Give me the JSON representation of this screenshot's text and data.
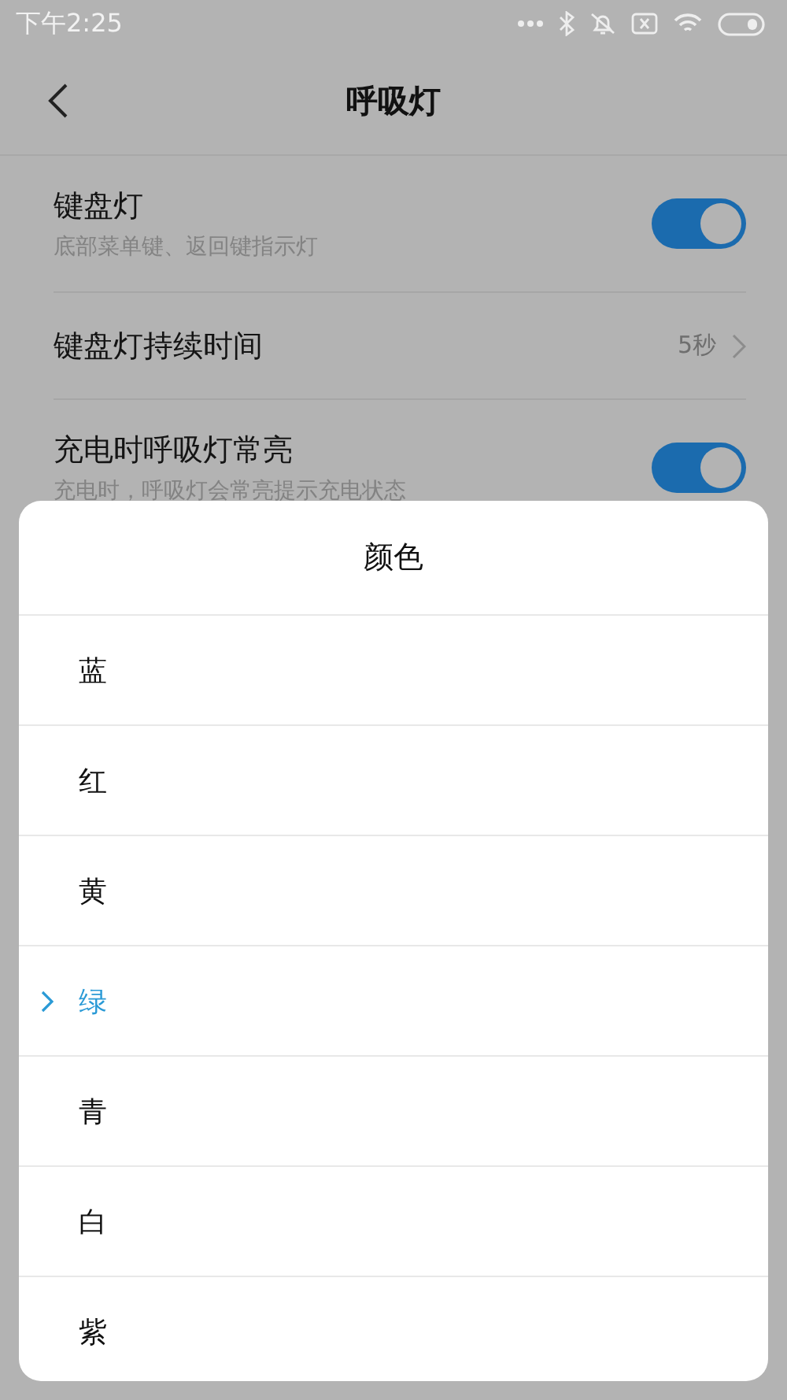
{
  "status_bar": {
    "time": "下午2:25"
  },
  "header": {
    "title": "呼吸灯"
  },
  "settings": [
    {
      "kind": "toggle",
      "title": "键盘灯",
      "subtitle": "底部菜单键、返回键指示灯",
      "on": true
    },
    {
      "kind": "value",
      "title": "键盘灯持续时间",
      "value": "5秒"
    },
    {
      "kind": "toggle",
      "title": "充电时呼吸灯常亮",
      "subtitle": "充电时，呼吸灯会常亮提示充电状态",
      "on": true
    }
  ],
  "dialog": {
    "title": "颜色",
    "options": [
      {
        "label": "蓝",
        "selected": false
      },
      {
        "label": "红",
        "selected": false
      },
      {
        "label": "黄",
        "selected": false
      },
      {
        "label": "绿",
        "selected": true
      },
      {
        "label": "青",
        "selected": false
      },
      {
        "label": "白",
        "selected": false
      },
      {
        "label": "紫",
        "selected": false
      }
    ]
  }
}
